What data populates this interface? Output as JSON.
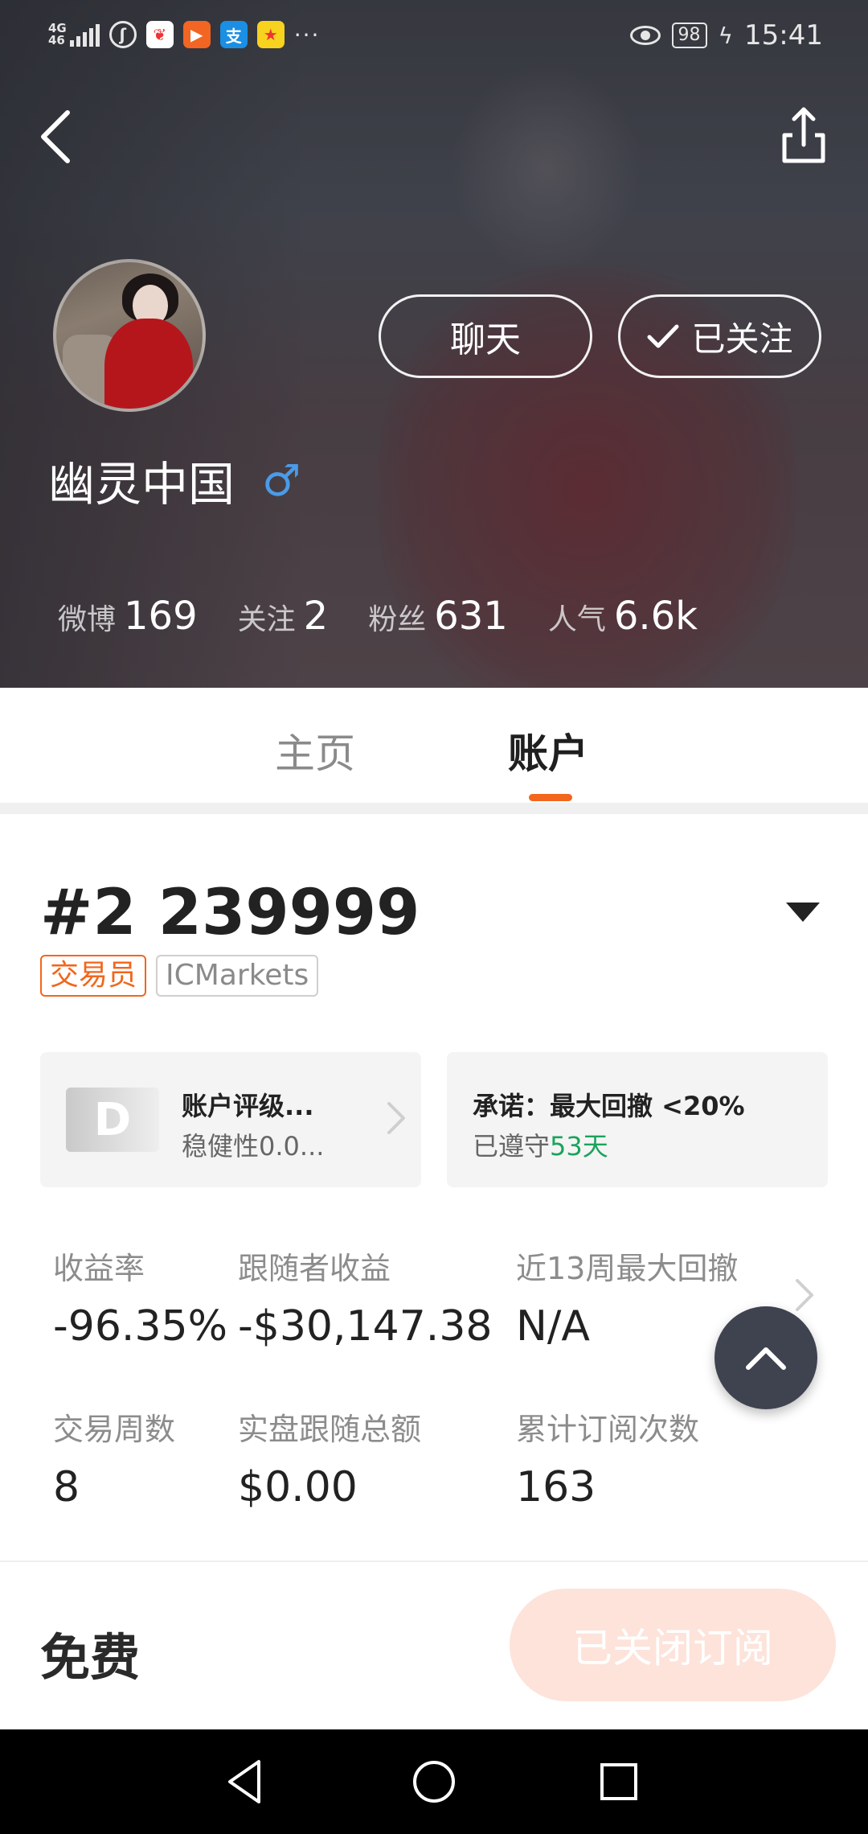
{
  "status_bar": {
    "network": "4G",
    "network_sub": "46",
    "battery": "98",
    "time": "15:41",
    "more": "···",
    "app_icons": [
      "weibo-icon",
      "shopping-icon",
      "video-icon",
      "alipay-icon",
      "star-icon"
    ]
  },
  "header": {
    "back_icon": "chevron-left-icon",
    "share_icon": "share-icon",
    "chat_label": "聊天",
    "follow_label": "已关注",
    "follow_icon": "checkmark-icon"
  },
  "profile": {
    "username": "幽灵中国",
    "gender_symbol": "♂",
    "stats": [
      {
        "label": "微博",
        "value": "169"
      },
      {
        "label": "关注",
        "value": "2"
      },
      {
        "label": "粉丝",
        "value": "631"
      },
      {
        "label": "人气",
        "value": "6.6k"
      }
    ]
  },
  "tabs": [
    {
      "label": "主页",
      "active": false
    },
    {
      "label": "账户",
      "active": true
    }
  ],
  "account": {
    "title": "#2 239999",
    "tags": [
      "交易员",
      "ICMarkets"
    ],
    "rating_grade": "D",
    "rating_title": "账户评级...",
    "rating_sub": "稳健性0.0...",
    "promise_title": "承诺：最大回撤 <20%",
    "promise_sub_prefix": "已遵守",
    "promise_days": "53天",
    "metrics": [
      {
        "label": "收益率",
        "value": "-96.35%"
      },
      {
        "label": "跟随者收益",
        "value": "-$30,147.38"
      },
      {
        "label": "近13周最大回撤",
        "value": "N/A"
      },
      {
        "label": "交易周数",
        "value": "8"
      },
      {
        "label": "实盘跟随总额",
        "value": "$0.00"
      },
      {
        "label": "累计订阅次数",
        "value": "163"
      }
    ]
  },
  "footer": {
    "price": "免费",
    "subscribe_label": "已关闭订阅"
  },
  "colors": {
    "accent": "#f2661d",
    "green": "#1aa35c",
    "gender": "#4a9be8",
    "fab": "#3f4350",
    "subscribe_disabled": "#fde3da"
  }
}
